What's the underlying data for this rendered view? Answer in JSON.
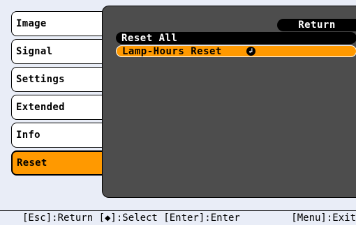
{
  "sidebar": {
    "tabs": [
      {
        "label": "Image"
      },
      {
        "label": "Signal"
      },
      {
        "label": "Settings"
      },
      {
        "label": "Extended"
      },
      {
        "label": "Info"
      },
      {
        "label": "Reset"
      }
    ],
    "active_index": 5
  },
  "panel": {
    "return_label": "Return",
    "items": [
      {
        "label": "Reset All"
      },
      {
        "label": "Lamp-Hours Reset",
        "icon": "enter-icon"
      }
    ],
    "selected_index": 1
  },
  "statusbar": {
    "left_text": "[Esc]:Return [◆]:Select [Enter]:Enter",
    "right_text": "[Menu]:Exit"
  },
  "colors": {
    "background": "#e9edf7",
    "panel": "#4d4d4d",
    "highlight": "#ff9900",
    "tab": "#ffffff",
    "black": "#000000"
  }
}
